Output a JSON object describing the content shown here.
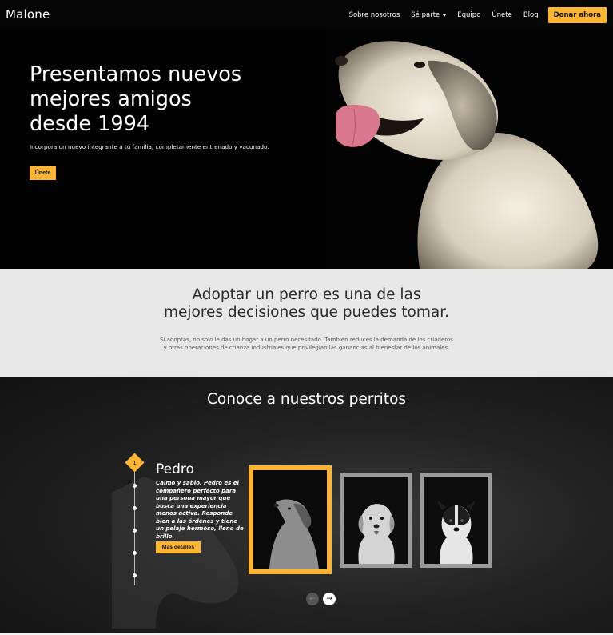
{
  "nav": {
    "brand": "Malone",
    "items": [
      {
        "label": "Sobre nosotros"
      },
      {
        "label": "Sé parte"
      },
      {
        "label": "Equipo"
      },
      {
        "label": "Únete"
      },
      {
        "label": "Blog"
      }
    ],
    "donate_label": "Donar ahora"
  },
  "hero": {
    "title": "Presentamos nuevos\nmejores amigos\ndesde 1994",
    "subtitle": "Incorpora un nuevo integrante a tu familia, completamente entrenado y vacunado.",
    "button_label": "Únete"
  },
  "info": {
    "heading": "Adoptar un perro es una de las\nmejores decisiones que puedes tomar.",
    "body": "Si adoptas, no solo le das un hogar a un perro necesitado. También reduces la demanda de los criaderos y otras operaciones de crianza industriales que privilegian las ganancias al bienestar de los animales."
  },
  "dogs": {
    "heading": "Conoce a nuestros perritos",
    "active_index": "1",
    "featured": {
      "name": "Pedro",
      "description": "Calmo y sabio, Pedro es el compañero perfecto para una persona mayor que busca una experiencia menos activa. Responde bien a las órdenes y tiene un pelaje hermoso, lleno de brillo.",
      "button_label": "Mas detalles"
    }
  },
  "colors": {
    "accent": "#fbb434",
    "dark": "#050505",
    "light_section": "#e8e8e8"
  }
}
